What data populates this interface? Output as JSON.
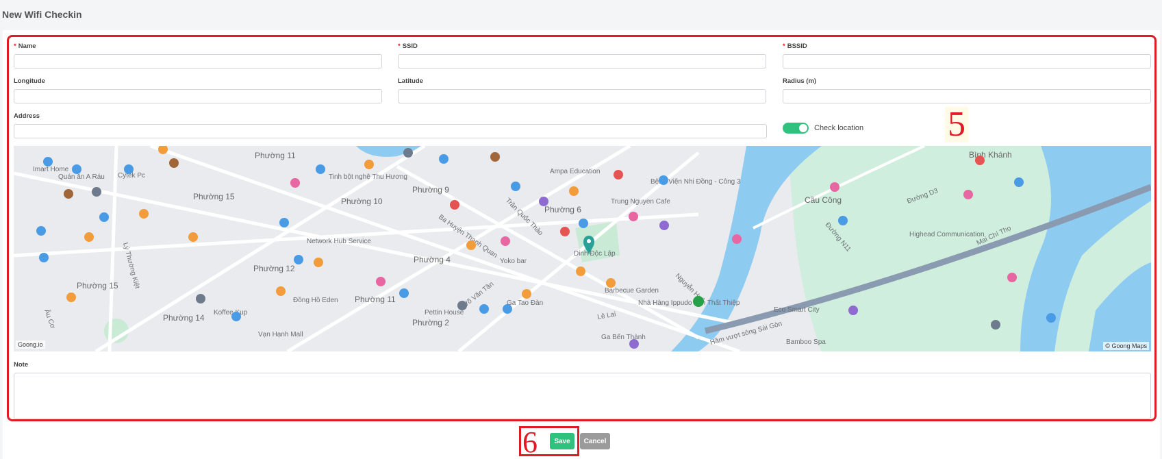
{
  "page": {
    "title": "New Wifi Checkin"
  },
  "form": {
    "name_label": "Name",
    "ssid_label": "SSID",
    "bssid_label": "BSSID",
    "longitude_label": "Longitude",
    "latitude_label": "Latitude",
    "radius_label": "Radius (m)",
    "address_label": "Address",
    "note_label": "Note",
    "required_mark": "*",
    "check_location_label": "Check location",
    "check_location_on": true
  },
  "map": {
    "center_marker": "Dinh Độc Lập",
    "areas": [
      "Phường 11",
      "Phường 15",
      "Phường 10",
      "Phường 9",
      "Phường 6",
      "Phường 4",
      "Phường 12",
      "Phường 15",
      "Phường 14",
      "Phường 11",
      "Phường 2",
      "Cầu Công",
      "Bình Khánh"
    ],
    "places": [
      "Imart Home",
      "Quán ăn A Ráu",
      "Cytek Pc",
      "Tinh bột nghệ Thu Hương",
      "Ampa Education",
      "Bệnh Viện Nhi Đồng - Công 3",
      "Trung Nguyen Cafe",
      "Network Hub Service",
      "Yoko bar",
      "Barbecue Garden",
      "Nhà Hàng Ippudo Tôn Thất Thiệp",
      "Ga Tao Đàn",
      "Ga Bến Thành",
      "Eco Smart City",
      "Bamboo Spa",
      "Pettin House",
      "Koffee Kup",
      "Vạn Hạnh Mall",
      "Đồng Hồ Eden",
      "Ba Huyện Thanh Quan",
      "Trần Quốc Thảo",
      "Võ Văn Tần",
      "Lê Lai",
      "Nguyễn Huệ",
      "Mai Chí Thọ",
      "Hầm vượt sông Sài Gòn",
      "Đường N11",
      "Đường D3",
      "Lý Thường Kiệt",
      "Âu Cơ",
      "Highead Communication"
    ],
    "attribution_left": "Goong.io",
    "attribution_right": "© Goong Maps"
  },
  "annotations": {
    "marker_5": "5",
    "marker_6": "6"
  },
  "actions": {
    "save_label": "Save",
    "cancel_label": "Cancel"
  },
  "colors": {
    "accent": "#2ec27e",
    "highlight": "#e01b24",
    "water": "#8ecbf1",
    "park": "#c9ead5"
  }
}
